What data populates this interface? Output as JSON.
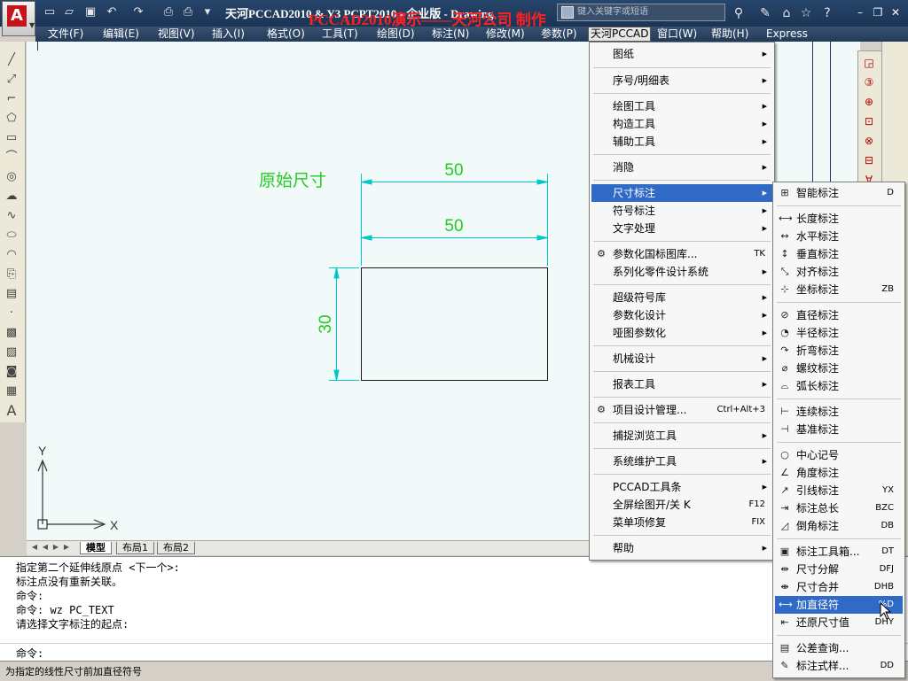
{
  "title": {
    "app_text": "天河PCCAD2010 & Y3 PCPT2010 - 企业版 - Drawing",
    "overlay": "PCCAD2010演示——天河公司 制作",
    "search_placeholder": "键入关键字或短语"
  },
  "menubar": [
    "文件(F)",
    "编辑(E)",
    "视图(V)",
    "插入(I)",
    "格式(O)",
    "工具(T)",
    "绘图(D)",
    "标注(N)",
    "修改(M)",
    "参数(P)",
    "天河PCCAD",
    "窗口(W)",
    "帮助(H)",
    "Express"
  ],
  "menu_main": [
    {
      "label": "图纸",
      "sub": true,
      "shortcut": ""
    },
    {
      "label": "序号/明细表",
      "sub": true,
      "shortcut": ""
    },
    {
      "label": "绘图工具",
      "sub": true,
      "shortcut": ""
    },
    {
      "label": "构造工具",
      "sub": true,
      "shortcut": ""
    },
    {
      "label": "辅助工具",
      "sub": true,
      "shortcut": ""
    },
    {
      "label": "消隐",
      "sub": true,
      "shortcut": ""
    },
    {
      "label": "尺寸标注",
      "sub": true,
      "shortcut": ""
    },
    {
      "label": "符号标注",
      "sub": true,
      "shortcut": ""
    },
    {
      "label": "文字处理",
      "sub": true,
      "shortcut": ""
    },
    {
      "label": "参数化国标图库...",
      "sub": false,
      "shortcut": "TK"
    },
    {
      "label": "系列化零件设计系统",
      "sub": true,
      "shortcut": ""
    },
    {
      "label": "超级符号库",
      "sub": true,
      "shortcut": ""
    },
    {
      "label": "参数化设计",
      "sub": true,
      "shortcut": ""
    },
    {
      "label": "哑图参数化",
      "sub": true,
      "shortcut": ""
    },
    {
      "label": "机械设计",
      "sub": true,
      "shortcut": ""
    },
    {
      "label": "报表工具",
      "sub": true,
      "shortcut": ""
    },
    {
      "label": "项目设计管理...",
      "sub": false,
      "shortcut": "Ctrl+Alt+3"
    },
    {
      "label": "捕捉浏览工具",
      "sub": true,
      "shortcut": ""
    },
    {
      "label": "系统维护工具",
      "sub": true,
      "shortcut": ""
    },
    {
      "label": "PCCAD工具条",
      "sub": true,
      "shortcut": ""
    },
    {
      "label": "全屏绘图开/关  K",
      "sub": false,
      "shortcut": "F12"
    },
    {
      "label": "菜单项修复",
      "sub": false,
      "shortcut": "FIX"
    },
    {
      "label": "帮助",
      "sub": true,
      "shortcut": ""
    }
  ],
  "menu_sub": [
    {
      "label": "智能标注",
      "shortcut": "D",
      "icon": "smart-dim-icon"
    },
    {
      "label": "长度标注",
      "shortcut": "",
      "icon": "length-dim-icon"
    },
    {
      "label": "水平标注",
      "shortcut": "",
      "icon": "horizontal-dim-icon"
    },
    {
      "label": "垂直标注",
      "shortcut": "",
      "icon": "vertical-dim-icon"
    },
    {
      "label": "对齐标注",
      "shortcut": "",
      "icon": "aligned-dim-icon"
    },
    {
      "label": "坐标标注",
      "shortcut": "ZB",
      "icon": "ordinate-dim-icon"
    },
    {
      "label": "直径标注",
      "shortcut": "",
      "icon": "diameter-dim-icon"
    },
    {
      "label": "半径标注",
      "shortcut": "",
      "icon": "radius-dim-icon"
    },
    {
      "label": "折弯标注",
      "shortcut": "",
      "icon": "jogged-dim-icon"
    },
    {
      "label": "螺纹标注",
      "shortcut": "",
      "icon": "thread-dim-icon"
    },
    {
      "label": "弧长标注",
      "shortcut": "",
      "icon": "arc-length-icon"
    },
    {
      "label": "连续标注",
      "shortcut": "",
      "icon": "continue-dim-icon"
    },
    {
      "label": "基准标注",
      "shortcut": "",
      "icon": "baseline-dim-icon"
    },
    {
      "label": "中心记号",
      "shortcut": "",
      "icon": "center-mark-icon"
    },
    {
      "label": "角度标注",
      "shortcut": "",
      "icon": "angle-dim-icon"
    },
    {
      "label": "引线标注",
      "shortcut": "YX",
      "icon": "leader-icon"
    },
    {
      "label": "标注总长",
      "shortcut": "BZC",
      "icon": "total-length-icon"
    },
    {
      "label": "倒角标注",
      "shortcut": "DB",
      "icon": "chamfer-dim-icon"
    },
    {
      "label": "标注工具箱...",
      "shortcut": "DT",
      "icon": "dim-toolbox-icon"
    },
    {
      "label": "尺寸分解",
      "shortcut": "DFJ",
      "icon": "dim-explode-icon"
    },
    {
      "label": "尺寸合并",
      "shortcut": "DHB",
      "icon": "dim-merge-icon"
    },
    {
      "label": "加直径符",
      "shortcut": "%D",
      "icon": "add-diameter-icon"
    },
    {
      "label": "还原尺寸值",
      "shortcut": "DHY",
      "icon": "restore-dim-icon"
    },
    {
      "label": "公差查询...",
      "shortcut": "",
      "icon": "tolerance-query-icon"
    },
    {
      "label": "标注式样...",
      "shortcut": "DD",
      "icon": "dim-style-icon"
    }
  ],
  "drawing": {
    "note": "原始尺寸",
    "dim_top": "50",
    "dim_mid": "50",
    "dim_left": "30",
    "axis_y": "Y",
    "axis_x": "X"
  },
  "tabs": [
    "模型",
    "布局1",
    "布局2"
  ],
  "command_history": [
    "指定第二个延伸线原点 <下一个>:",
    "标注点没有重新关联。",
    "命令:",
    "命令: wz PC_TEXT",
    "请选择文字标注的起点:"
  ],
  "command_prompt": "命令:",
  "status_text": "为指定的线性尺寸前加直径符号",
  "colors": {
    "dimension": "#00c8c8",
    "dim_text": "#22cc22",
    "highlight": "#3169c6"
  }
}
